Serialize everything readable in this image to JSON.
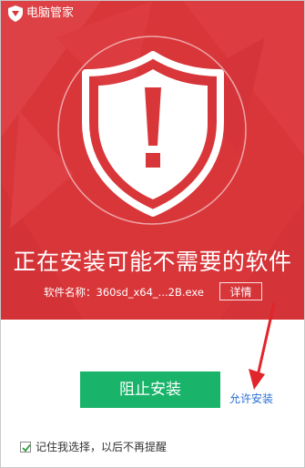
{
  "app": {
    "title": "电脑管家"
  },
  "alert": {
    "headline": "正在安装可能不需要的软件",
    "file_label": "软件名称：",
    "file_name": "360sd_x64_...2B.exe",
    "details_label": "详情"
  },
  "actions": {
    "block_label": "阻止安装",
    "allow_label": "允许安装"
  },
  "footer": {
    "remember_label": "记住我选择，以后不再提醒",
    "remember_checked": true
  },
  "colors": {
    "alert_red": "#d9363a",
    "block_green": "#19b369",
    "link_blue": "#2a6fd6",
    "arrow_red": "#e0252b"
  },
  "icons": {
    "logo": "shield-logo-icon",
    "warning": "shield-warning-icon",
    "check": "checkmark-icon"
  }
}
